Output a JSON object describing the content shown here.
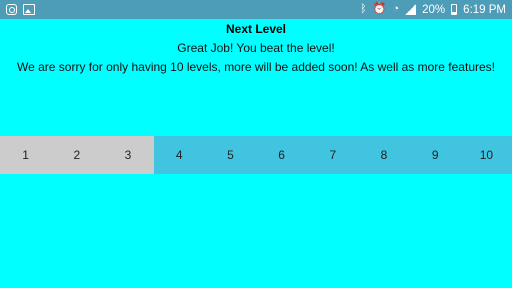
{
  "status_bar": {
    "battery": "20%",
    "time": "6:19 PM",
    "left_icons": [
      "instagram-icon",
      "gallery-icon"
    ],
    "right_icons": [
      "bluetooth-icon",
      "alarm-icon",
      "wifi-icon",
      "signal-icon",
      "battery-icon"
    ]
  },
  "main": {
    "title": "Next Level",
    "message": "Great Job! You beat the level!",
    "note": "We are sorry for only having 10 levels, more will be added soon! As well as more features!"
  },
  "levels": [
    {
      "label": "1",
      "unlocked": true
    },
    {
      "label": "2",
      "unlocked": true
    },
    {
      "label": "3",
      "unlocked": true
    },
    {
      "label": "4",
      "unlocked": false
    },
    {
      "label": "5",
      "unlocked": false
    },
    {
      "label": "6",
      "unlocked": false
    },
    {
      "label": "7",
      "unlocked": false
    },
    {
      "label": "8",
      "unlocked": false
    },
    {
      "label": "9",
      "unlocked": false
    },
    {
      "label": "10",
      "unlocked": false
    }
  ],
  "colors": {
    "background": "#00FFFF",
    "status_bar": "#4d9db8",
    "level_unlocked": "#cccccc",
    "level_locked": "#40C4E0"
  }
}
